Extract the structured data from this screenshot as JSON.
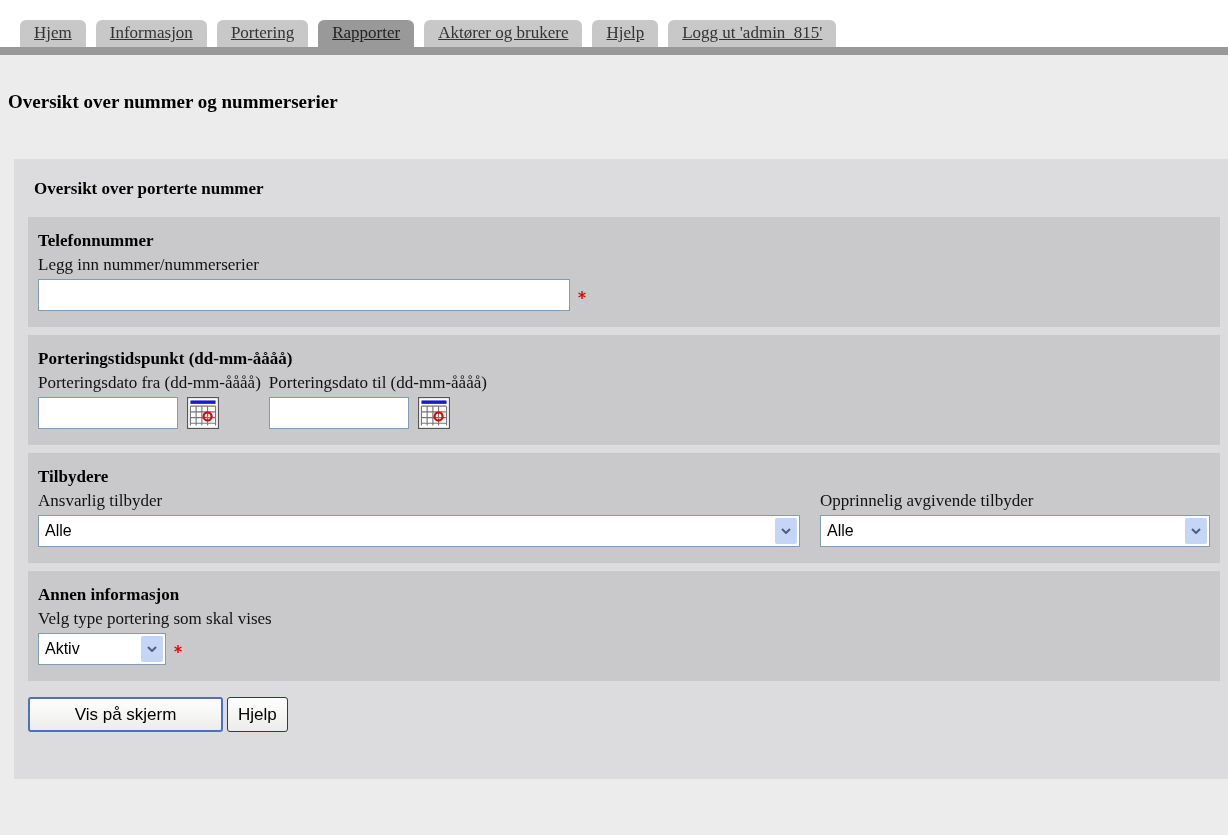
{
  "tabs": [
    {
      "label": "Hjem",
      "selected": false
    },
    {
      "label": "Informasjon",
      "selected": false
    },
    {
      "label": "Portering",
      "selected": false
    },
    {
      "label": "Rapporter",
      "selected": true
    },
    {
      "label": "Aktører og brukere",
      "selected": false
    },
    {
      "label": "Hjelp",
      "selected": false
    },
    {
      "label": "Logg ut 'admin_815'",
      "selected": false
    }
  ],
  "page_title": "Oversikt over nummer og nummerserier",
  "form_title": "Oversikt over porterte nummer",
  "sections": [
    {
      "title": "Telefonnummer",
      "kind": "single",
      "fields": [
        {
          "kind": "text",
          "label": "Legg inn nummer/nummerserier",
          "required": true
        }
      ]
    },
    {
      "title": "Porteringstidspunkt (dd-mm-åååå)",
      "kind": "inline",
      "fields": [
        {
          "kind": "date",
          "label": "Porteringsdato fra (dd-mm-åååå)",
          "required": false
        },
        {
          "kind": "date",
          "label": "Porteringsdato til (dd-mm-åååå)",
          "required": false
        }
      ]
    },
    {
      "title": "Tilbydere",
      "kind": "split",
      "fields": [
        {
          "kind": "select",
          "label": "Ansvarlig tilbyder",
          "value": "Alle",
          "required": false
        },
        {
          "kind": "select",
          "label": "Opprinnelig avgivende tilbyder",
          "value": "Alle",
          "required": false
        }
      ]
    },
    {
      "title": "Annen informasjon",
      "kind": "single",
      "fields": [
        {
          "kind": "select",
          "label": "Velg type portering som skal vises",
          "value": "Aktiv",
          "required": true
        }
      ]
    }
  ],
  "buttons": [
    {
      "label": "Vis på skjerm",
      "kind": "primary"
    },
    {
      "label": "Hjelp",
      "kind": "default"
    }
  ]
}
